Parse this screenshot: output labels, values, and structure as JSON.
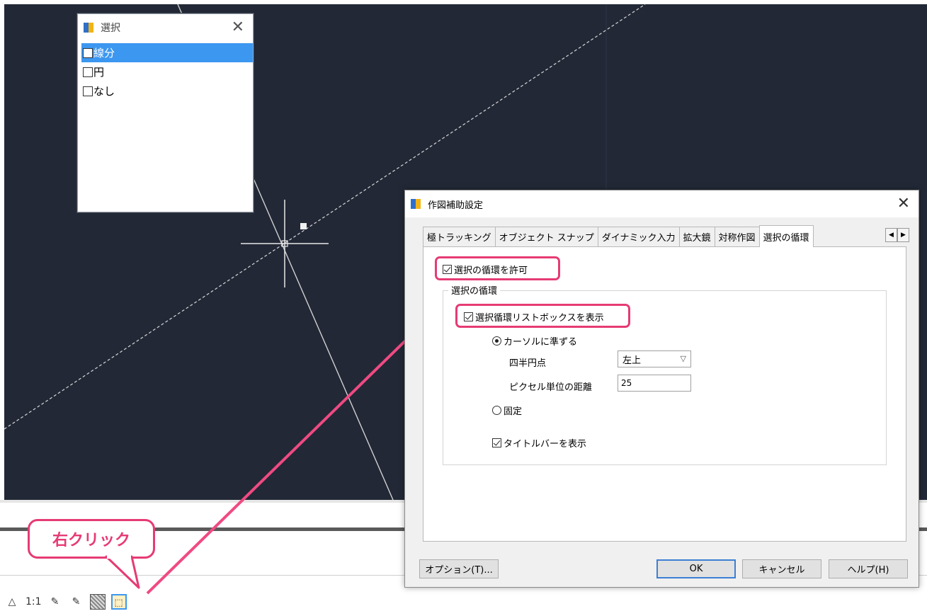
{
  "select_box": {
    "title": "選択",
    "close_glyph": "✕",
    "items": [
      {
        "label": "線分"
      },
      {
        "label": "円"
      },
      {
        "label": "なし"
      }
    ]
  },
  "callout": {
    "text": "右クリック"
  },
  "status_bar": {
    "annotation_scale": "1:1"
  },
  "dialog": {
    "title": "作図補助設定",
    "close_glyph": "✕",
    "tabs": [
      {
        "label": "極トラッキング"
      },
      {
        "label": "オブジェクト スナップ"
      },
      {
        "label": "ダイナミック入力"
      },
      {
        "label": "拡大鏡"
      },
      {
        "label": "対称作図"
      },
      {
        "label": "選択の循環"
      }
    ],
    "allow_cycling_label": "選択の循環を許可",
    "group_label": "選択の循環",
    "show_listbox_label": "選択循環リストボックスを表示",
    "cursor_radio_label": "カーソルに準ずる",
    "quadrant_label": "四半円点",
    "quadrant_value": "左上",
    "pixel_distance_label": "ピクセル単位の距離",
    "pixel_distance_value": "25",
    "fixed_radio_label": "固定",
    "show_titlebar_label": "タイトルバーを表示",
    "buttons": {
      "options": "オプション(T)...",
      "ok": "OK",
      "cancel": "キャンセル",
      "help": "ヘルプ(H)"
    }
  },
  "colors": {
    "canvas_bg": "#222836",
    "highlight": "#e63b73",
    "selection_blue": "#3c97f0"
  }
}
